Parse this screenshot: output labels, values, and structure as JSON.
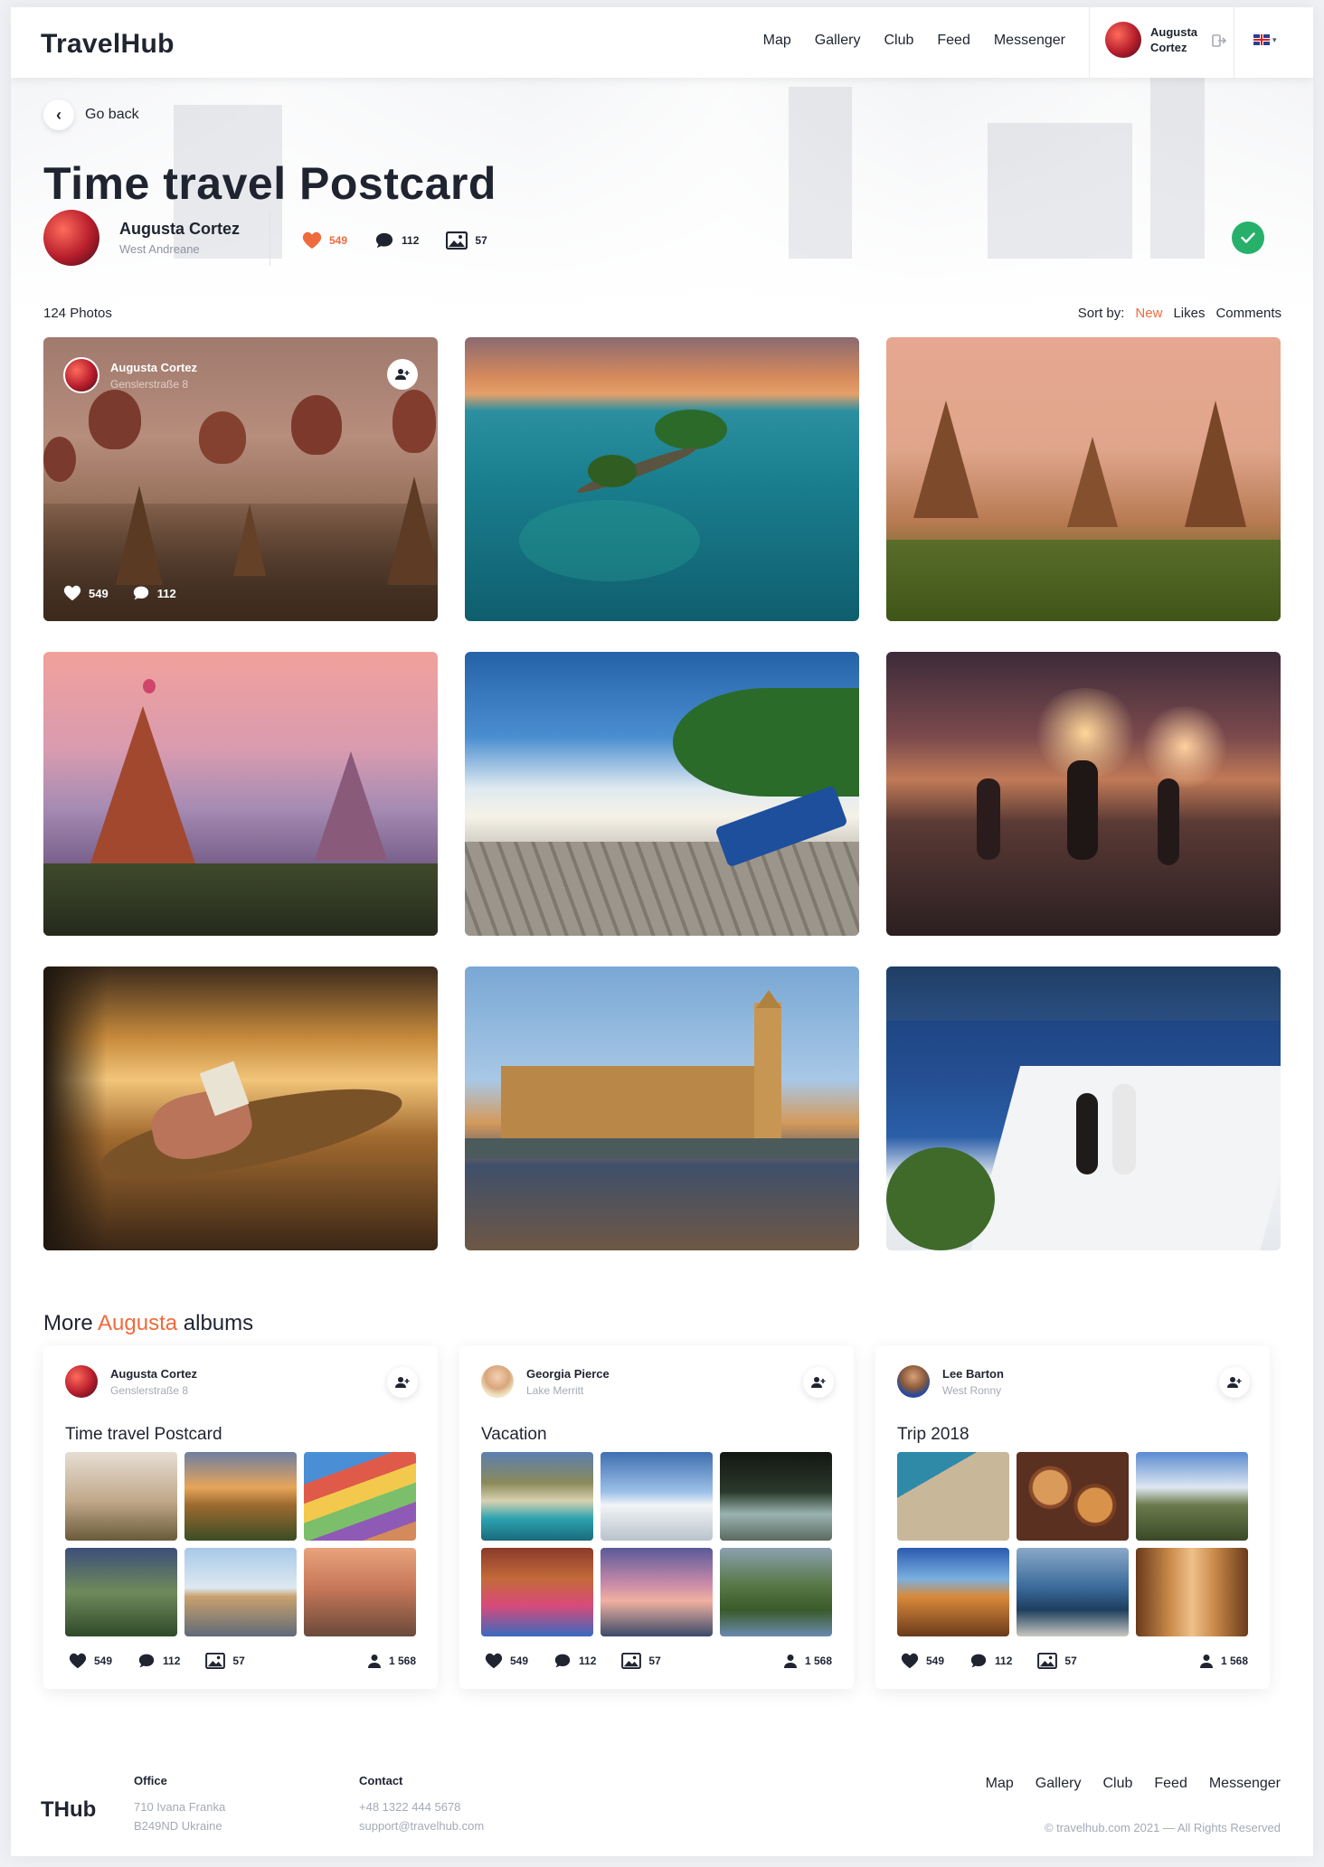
{
  "app": {
    "logo": "TravelHub",
    "footer_logo": "THub"
  },
  "nav": [
    "Map",
    "Gallery",
    "Club",
    "Feed",
    "Messenger"
  ],
  "user": {
    "name": "Augusta Cortez"
  },
  "page": {
    "back_label": "Go back",
    "title": "Time travel Postcard",
    "author_name": "Augusta Cortez",
    "author_location": "West Andreane",
    "likes": "549",
    "comments": "112",
    "photos": "57"
  },
  "gallery": {
    "count_label": "124 Photos",
    "sort_label": "Sort by:",
    "sort_options": [
      "New",
      "Likes",
      "Comments"
    ],
    "active_sort": "New",
    "hover_card": {
      "name": "Augusta Cortez",
      "location": "Genslerstraße 8",
      "likes": "549",
      "comments": "112"
    },
    "photos": [
      "balloons-over-temples",
      "tropical-island-sea",
      "temple-plains-sunset",
      "pagoda-pink-sky",
      "beach-deck-lounger",
      "beach-fireworks-party",
      "hammock-reading",
      "westminster-big-ben",
      "santorini-couple"
    ]
  },
  "more_albums": {
    "prefix": "More",
    "highlight": "Augusta",
    "suffix": "albums"
  },
  "albums": [
    {
      "author": "Augusta Cortez",
      "location": "Genslerstraße 8",
      "title": "Time travel Postcard",
      "likes": "549",
      "comments": "112",
      "photos": "57",
      "followers": "1 568"
    },
    {
      "author": "Georgia Pierce",
      "location": "Lake Merritt",
      "title": "Vacation",
      "likes": "549",
      "comments": "112",
      "photos": "57",
      "followers": "1 568"
    },
    {
      "author": "Lee Barton",
      "location": "West Ronny",
      "title": "Trip 2018",
      "likes": "549",
      "comments": "112",
      "photos": "57",
      "followers": "1 568"
    }
  ],
  "footer": {
    "office_label": "Office",
    "office_line1": "710 Ivana Franka",
    "office_line2": "B249ND Ukraine",
    "contact_label": "Contact",
    "phone": "+48 1322 444 5678",
    "email": "support@travelhub.com",
    "copyright": "© travelhub.com 2021 — All Rights Reserved"
  },
  "colors": {
    "accent": "#ef6a3c",
    "confirm": "#27b06a",
    "text": "#1f2430",
    "muted": "#a4aab5"
  }
}
